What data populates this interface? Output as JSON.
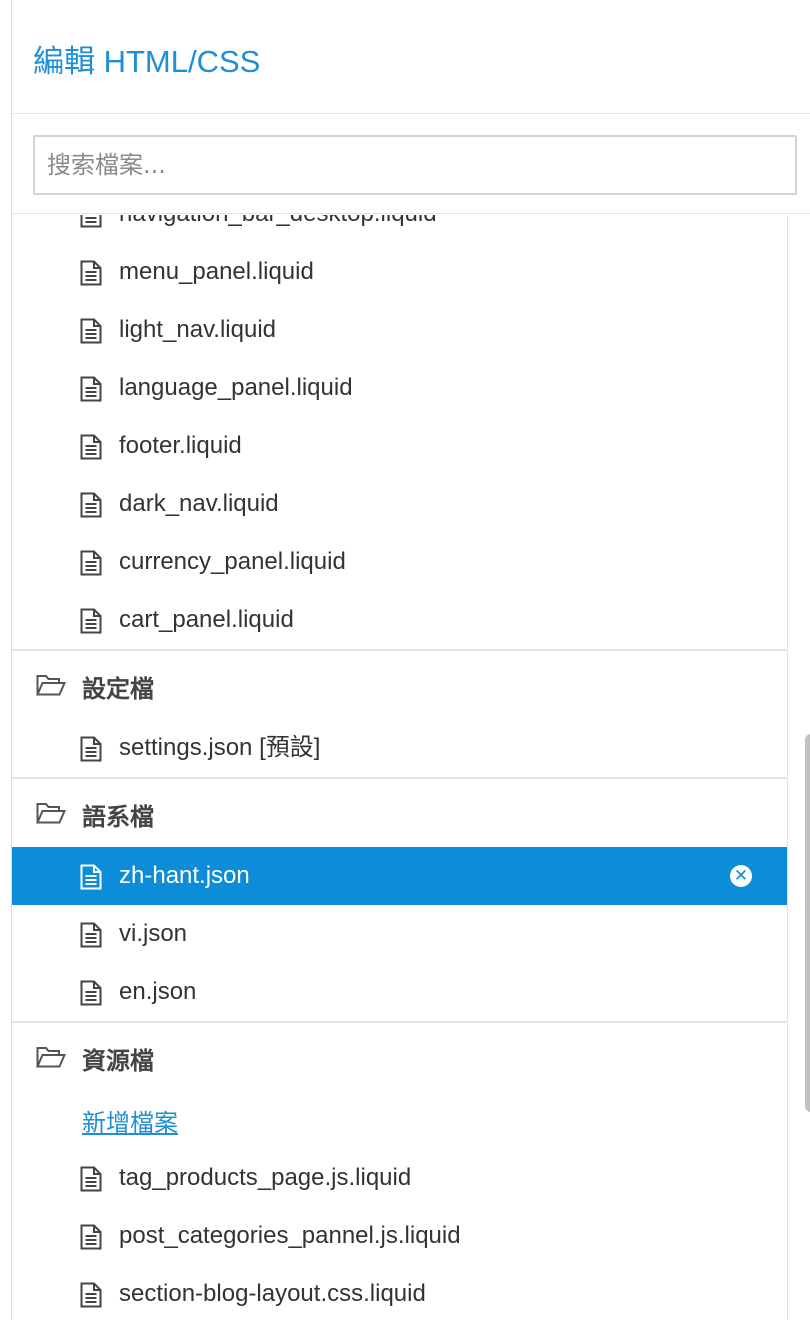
{
  "header": {
    "title": "編輯 HTML/CSS"
  },
  "search": {
    "placeholder": "搜索檔案..."
  },
  "groups": [
    {
      "folder": null,
      "files": [
        "navigation_bar_desktop.liquid",
        "menu_panel.liquid",
        "light_nav.liquid",
        "language_panel.liquid",
        "footer.liquid",
        "dark_nav.liquid",
        "currency_panel.liquid",
        "cart_panel.liquid"
      ]
    },
    {
      "folder": "設定檔",
      "files": [
        "settings.json [預設]"
      ]
    },
    {
      "folder": "語系檔",
      "files": [
        "zh-hant.json",
        "vi.json",
        "en.json"
      ],
      "active": "zh-hant.json"
    },
    {
      "folder": "資源檔",
      "add_file": "新增檔案",
      "files": [
        "tag_products_page.js.liquid",
        "post_categories_pannel.js.liquid",
        "section-blog-layout.css.liquid"
      ]
    }
  ],
  "colors": {
    "accent": "#0d8cd8",
    "title": "#1e8fd6"
  },
  "icons": {
    "file": "file-text-icon",
    "folder": "folder-open-icon",
    "close": "close-circle-icon"
  }
}
